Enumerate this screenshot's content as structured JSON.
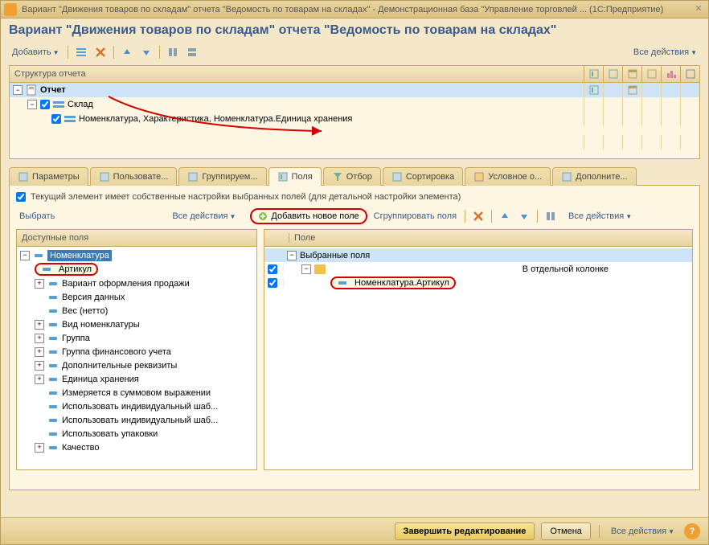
{
  "window": {
    "title": "Вариант \"Движения товаров по складам\" отчета \"Ведомость по товарам на складах\" - Демонстрационная база \"Управление торговлей ...   (1С:Предприятие)"
  },
  "heading": "Вариант \"Движения товаров по складам\" отчета \"Ведомость по товарам на складах\"",
  "toolbar": {
    "add": "Добавить",
    "all_actions": "Все действия"
  },
  "structure": {
    "header": "Структура отчета",
    "report": "Отчет",
    "warehouse": "Склад",
    "nomenclature": "Номенклатура, Характеристика, Номенклатура.Единица хранения"
  },
  "tabs": {
    "params": "Параметры",
    "user": "Пользовате...",
    "group": "Группируем...",
    "fields": "Поля",
    "filter": "Отбор",
    "sort": "Сортировка",
    "cond": "Условное о...",
    "extra": "Дополните..."
  },
  "fields_tab": {
    "hint": "Текущий элемент имеет собственные настройки выбранных полей (для детальной настройки элемента)",
    "select": "Выбрать",
    "all_actions": "Все действия",
    "add_new": "Добавить новое поле",
    "group_fields": "Сгруппировать поля",
    "left_header": "Доступные поля",
    "right_header": "Поле",
    "right_col_label": "В отдельной колонке",
    "selected_fields": "Выбранные поля",
    "nom_article": "Номенклатура.Артикул"
  },
  "available_fields": {
    "root": "Номенклатура",
    "items": [
      "Артикул",
      "Вариант оформления продажи",
      "Версия данных",
      "Вес (нетто)",
      "Вид номенклатуры",
      "Группа",
      "Группа финансового учета",
      "Дополнительные реквизиты",
      "Единица хранения",
      "Измеряется в суммовом выражении",
      "Использовать индивидуальный шаб...",
      "Использовать индивидуальный шаб...",
      "Использовать упаковки",
      "Качество"
    ]
  },
  "footer": {
    "finish": "Завершить редактирование",
    "cancel": "Отмена",
    "all_actions": "Все действия"
  }
}
